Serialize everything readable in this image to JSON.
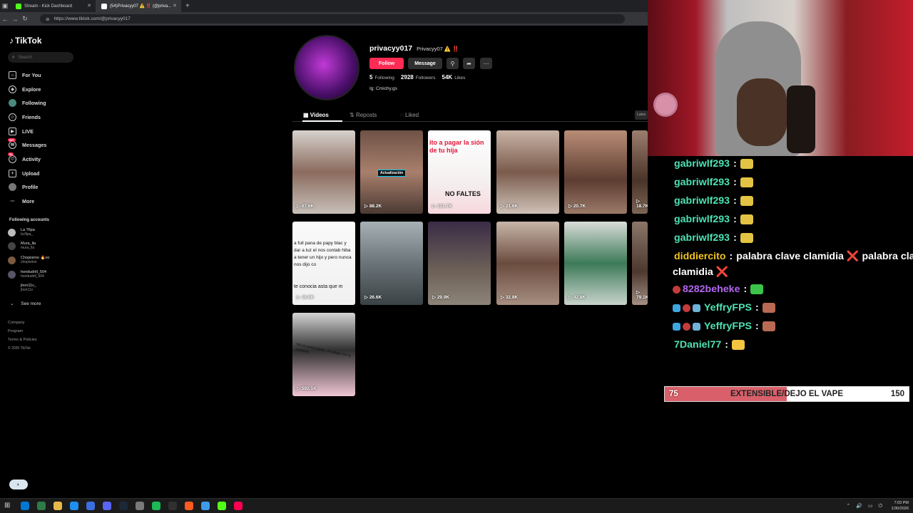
{
  "browser": {
    "tabs": [
      {
        "label": "Stream - Kick Dashboard",
        "icon_color": "#53fc18"
      },
      {
        "label": "(54)Privacyy07 ⚠️ ‼️ (@priva...",
        "icon_color": "#ffffff",
        "active": true
      }
    ],
    "url": "https://www.tiktok.com/@privacyy017"
  },
  "sidebar": {
    "brand": "TikTok",
    "search_placeholder": "Search",
    "nav": [
      {
        "label": "For You",
        "icon": "home-icon"
      },
      {
        "label": "Explore",
        "icon": "compass-icon"
      },
      {
        "label": "Following",
        "icon": "following-icon"
      },
      {
        "label": "Friends",
        "icon": "friends-icon"
      },
      {
        "label": "LIVE",
        "icon": "live-icon"
      },
      {
        "label": "Messages",
        "icon": "messages-icon",
        "badge": "99+"
      },
      {
        "label": "Activity",
        "icon": "activity-icon",
        "badge": "54"
      },
      {
        "label": "Upload",
        "icon": "upload-icon"
      },
      {
        "label": "Profile",
        "icon": "profile-icon"
      },
      {
        "label": "More",
        "icon": "more-icon"
      }
    ],
    "following_heading": "Following accounts",
    "accounts": [
      {
        "name": "La Tfipa",
        "handle": "la.flipa_"
      },
      {
        "name": "Mura_lla",
        "handle": "mura_lla"
      },
      {
        "name": "Chopisimo 🔥oo",
        "handle": "chopisimo"
      },
      {
        "name": "hondudrill_504",
        "handle": "hondudrill_504"
      },
      {
        "name": "jhon11v_",
        "handle": "jhon11v"
      }
    ],
    "see_more": "See more",
    "footer": [
      "Company",
      "Program",
      "Terms & Policies",
      "© 2026 TikTok"
    ]
  },
  "profile": {
    "username": "privacyy017",
    "nickname": "Privacyy07 ⚠️ ‼️",
    "follow_label": "Follow",
    "message_label": "Message",
    "following_count": "5",
    "following_label": "Following",
    "followers_count": "2928",
    "followers_label": "Followers",
    "likes_count": "54K",
    "likes_label": "Likes",
    "bio": "Ig: Cmichy.gs",
    "tabs": [
      "Videos",
      "Reposts",
      "Liked"
    ],
    "latest_label": "Lates"
  },
  "videos": [
    {
      "views": "67.6K",
      "bg": "linear-gradient(180deg,#d7d1cc,#8b6b5d 50%,#c8c0ba)"
    },
    {
      "views": "88.2K",
      "bg": "linear-gradient(180deg,#6e5246,#a97f6c 50%,#4b3a33)",
      "caption": "Actualización"
    },
    {
      "views": "131.7K",
      "bg": "linear-gradient(180deg,#ffffff,#f4f0f0 60%,#f7d8de)",
      "caption": "ito a pagar la sión de tu hija",
      "caption2": "NO FALTES"
    },
    {
      "views": "21.6K",
      "bg": "linear-gradient(180deg,#c8b3a6,#7a5b4c 50%,#cfc1b8)"
    },
    {
      "views": "20.7K",
      "bg": "linear-gradient(180deg,#b98d76,#5c3d31 60%,#9b7a69)"
    },
    {
      "views": "18.7K",
      "bg": "linear-gradient(180deg,#9c7e6d,#4a3329 60%,#7d6657)"
    },
    {
      "views": "18.6K",
      "bg": "linear-gradient(180deg,#fafafa,#f0f0f0)",
      "caption": "a full pana de papy blac y dar a luz el nos contab hiba a tener un hijo y pero nunca nos dijo co",
      "caption2": "te conocia asta que m"
    },
    {
      "views": "26.6K",
      "bg": "linear-gradient(180deg,#a7b1b5,#6b7478 50%,#3a4245)"
    },
    {
      "views": "29.9K",
      "bg": "linear-gradient(180deg,#3a2c46,#6e6258 60%,#8d8479)"
    },
    {
      "views": "32.8K",
      "bg": "linear-gradient(180deg,#c7b5a8,#6b4c3f 50%,#a68e80)"
    },
    {
      "views": "42.8K",
      "bg": "linear-gradient(180deg,#d9dcd8,#3c7a58 50%,#c9d3cc)"
    },
    {
      "views": "79.1K",
      "bg": "linear-gradient(180deg,#8b7669,#4d382f 60%,#a58f83)"
    },
    {
      "views": "592.1K",
      "bg": "linear-gradient(180deg,#d4d4d4,#2f2f2f 45%,#f1c6d4)",
      "caption": "No te preocupes, mi papá me lo compra"
    }
  ],
  "chat": [
    {
      "user": "gabriwlf293",
      "color": "#4de3b4",
      "emote": "#e3c343"
    },
    {
      "user": "gabriwlf293",
      "color": "#4de3b4",
      "emote": "#e3c343"
    },
    {
      "user": "gabriwlf293",
      "color": "#4de3b4",
      "emote": "#e3c343"
    },
    {
      "user": "gabriwlf293",
      "color": "#4de3b4",
      "emote": "#e3c343"
    },
    {
      "user": "gabriwlf293",
      "color": "#4de3b4",
      "emote": "#e3c343"
    },
    {
      "user": "diddiercito",
      "color": "#f0c420",
      "text": "palabra clave clamidia ❌ palabra clave c",
      "text2": "clamidia ❌"
    },
    {
      "user": "8282beheke",
      "color": "#b267f0",
      "emote": "#3cc44a",
      "badge": true
    },
    {
      "user": "YeffryFPS",
      "color": "#4de3b4",
      "emote": "#b86a52",
      "badge": true
    },
    {
      "user": "YeffryFPS",
      "color": "#4de3b4",
      "emote": "#b86a52",
      "badge": true
    },
    {
      "user": "7Daniel77",
      "color": "#4de3b4",
      "emote": "#f5c542"
    }
  ],
  "goal": {
    "current": "75",
    "target": "150",
    "label": "EXTENSIBLE/DEJO EL VAPE",
    "fraction": 0.5,
    "fill_color": "#d9606a"
  },
  "taskbar": {
    "time": "7:03 PM",
    "date": "1/30/2026",
    "apps": [
      "#0078d4",
      "#2d7d46",
      "#e8b84a",
      "#1f8ef1",
      "#3b6fe0",
      "#5865f2",
      "#1b2838",
      "#7a7a7a",
      "#1db954",
      "#303030",
      "#ff5a1f",
      "#3d9be9",
      "#53fc18",
      "#ff0050"
    ]
  }
}
